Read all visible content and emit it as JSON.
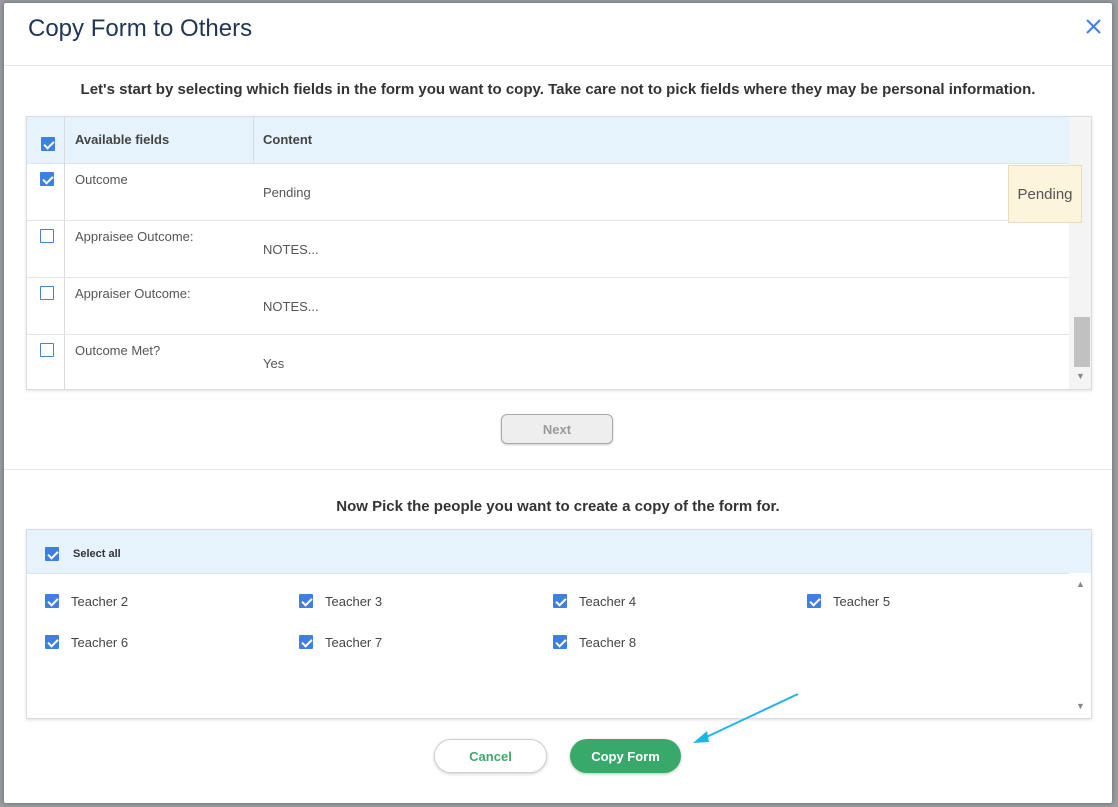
{
  "modal": {
    "title": "Copy Form to Others"
  },
  "fields": {
    "instructions": "Let's start by selecting which fields in the form you want to copy. Take care not to pick fields where they may be personal information.",
    "header_available": "Available fields",
    "header_content": "Content",
    "header_checked": true,
    "rows": [
      {
        "field": "Outcome",
        "content": "Pending",
        "checked": true
      },
      {
        "field": "Appraisee Outcome:",
        "content": "NOTES...",
        "checked": false
      },
      {
        "field": "Appraiser Outcome:",
        "content": "NOTES...",
        "checked": false
      },
      {
        "field": "Outcome Met?",
        "content": "Yes",
        "checked": false
      }
    ],
    "tooltip": "Pending",
    "next_label": "Next"
  },
  "people": {
    "instructions": "Now Pick the people you want to create a copy of the form for.",
    "select_all_label": "Select all",
    "list": [
      {
        "name": "Teacher 2",
        "checked": true
      },
      {
        "name": "Teacher 3",
        "checked": true
      },
      {
        "name": "Teacher 4",
        "checked": true
      },
      {
        "name": "Teacher 5",
        "checked": true
      },
      {
        "name": "Teacher 6",
        "checked": true
      },
      {
        "name": "Teacher 7",
        "checked": true
      },
      {
        "name": "Teacher 8",
        "checked": true
      }
    ]
  },
  "actions": {
    "cancel_label": "Cancel",
    "copy_label": "Copy Form"
  },
  "colors": {
    "accent_blue": "#3f7fe0",
    "copy_green": "#38a96a",
    "annotation_arrow": "#1fb3e8",
    "title": "#1f3553"
  },
  "icons": {
    "close": "close-icon",
    "scroll_up": "scroll-up-arrow-icon",
    "scroll_down": "scroll-down-arrow-icon",
    "annotation": "annotation-arrow-icon"
  }
}
